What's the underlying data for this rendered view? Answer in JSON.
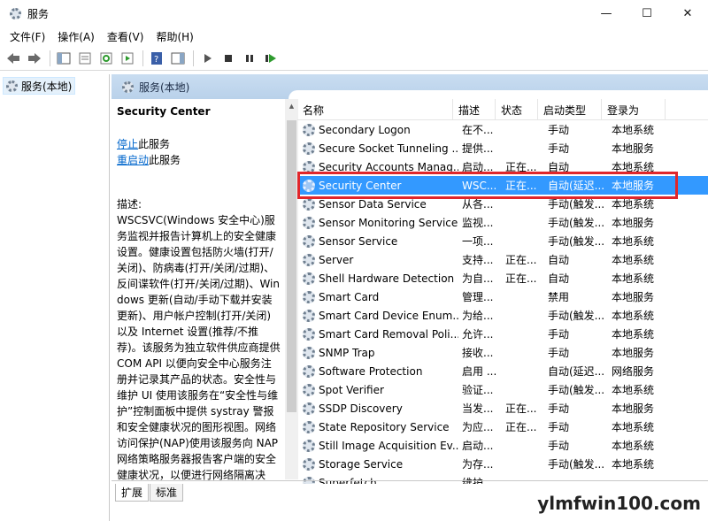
{
  "window": {
    "title": "服务",
    "minimize": "—",
    "maximize": "☐",
    "close": "✕"
  },
  "menu": [
    "文件(F)",
    "操作(A)",
    "查看(V)",
    "帮助(H)"
  ],
  "toolbar": {
    "icons": [
      "back-icon",
      "forward-icon",
      "show-tree-icon",
      "properties-icon",
      "refresh-icon",
      "export-list-icon",
      "help-icon",
      "show-action-pane-icon",
      "start-icon",
      "stop-icon",
      "pause-icon",
      "restart-icon"
    ]
  },
  "tree": {
    "item": "服务(本地)"
  },
  "pane": {
    "header": "服务(本地)"
  },
  "desc": {
    "service_title": "Security Center",
    "stop_link": "停止",
    "stop_rest": "此服务",
    "restart_link": "重启动",
    "restart_rest": "此服务",
    "label": "描述:",
    "text": "WSCSVC(Windows 安全中心)服务监视并报告计算机上的安全健康设置。健康设置包括防火墙(打开/关闭)、防病毒(打开/关闭/过期)、反间谍软件(打开/关闭/过期)、Windows 更新(自动/手动下载并安装更新)、用户帐户控制(打开/关闭)以及 Internet 设置(推荐/不推荐)。该服务为独立软件供应商提供 COM API 以便向安全中心服务注册并记录其产品的状态。安全性与维护 UI 使用该服务在“安全性与维护”控制面板中提供 systray 警报和安全健康状况的图形视图。网络访问保护(NAP)使用该服务向 NAP 网络策略服务器报告客户端的安全健康状况，以便进行网络隔离决策。该服务还提供一个公共"
  },
  "columns": [
    "名称",
    "描述",
    "状态",
    "启动类型",
    "登录为"
  ],
  "services": [
    {
      "name": "Secondary Logon",
      "desc": "在不...",
      "status": "",
      "startup": "手动",
      "logon": "本地系统"
    },
    {
      "name": "Secure Socket Tunneling ...",
      "desc": "提供...",
      "status": "",
      "startup": "手动",
      "logon": "本地服务"
    },
    {
      "name": "Security Accounts Manag...",
      "desc": "启动...",
      "status": "正在...",
      "startup": "自动",
      "logon": "本地系统"
    },
    {
      "name": "Security Center",
      "desc": "WSC...",
      "status": "正在...",
      "startup": "自动(延迟...",
      "logon": "本地服务"
    },
    {
      "name": "Sensor Data Service",
      "desc": "从各...",
      "status": "",
      "startup": "手动(触发...",
      "logon": "本地系统"
    },
    {
      "name": "Sensor Monitoring Service",
      "desc": "监视...",
      "status": "",
      "startup": "手动(触发...",
      "logon": "本地服务"
    },
    {
      "name": "Sensor Service",
      "desc": "一项...",
      "status": "",
      "startup": "手动(触发...",
      "logon": "本地系统"
    },
    {
      "name": "Server",
      "desc": "支持...",
      "status": "正在...",
      "startup": "自动",
      "logon": "本地系统"
    },
    {
      "name": "Shell Hardware Detection",
      "desc": "为自...",
      "status": "正在...",
      "startup": "自动",
      "logon": "本地系统"
    },
    {
      "name": "Smart Card",
      "desc": "管理...",
      "status": "",
      "startup": "禁用",
      "logon": "本地服务"
    },
    {
      "name": "Smart Card Device Enum...",
      "desc": "为给...",
      "status": "",
      "startup": "手动(触发...",
      "logon": "本地系统"
    },
    {
      "name": "Smart Card Removal Poli...",
      "desc": "允许...",
      "status": "",
      "startup": "手动",
      "logon": "本地系统"
    },
    {
      "name": "SNMP Trap",
      "desc": "接收...",
      "status": "",
      "startup": "手动",
      "logon": "本地服务"
    },
    {
      "name": "Software Protection",
      "desc": "启用 ...",
      "status": "",
      "startup": "自动(延迟...",
      "logon": "网络服务"
    },
    {
      "name": "Spot Verifier",
      "desc": "验证...",
      "status": "",
      "startup": "手动(触发...",
      "logon": "本地系统"
    },
    {
      "name": "SSDP Discovery",
      "desc": "当发...",
      "status": "正在...",
      "startup": "手动",
      "logon": "本地服务"
    },
    {
      "name": "State Repository Service",
      "desc": "为应...",
      "status": "正在...",
      "startup": "手动",
      "logon": "本地系统"
    },
    {
      "name": "Still Image Acquisition Ev...",
      "desc": "启动...",
      "status": "",
      "startup": "手动",
      "logon": "本地系统"
    },
    {
      "name": "Storage Service",
      "desc": "为存...",
      "status": "",
      "startup": "手动(触发...",
      "logon": "本地系统"
    },
    {
      "name": "Superfetch",
      "desc": "维护...",
      "status": "",
      "startup": "",
      "logon": ""
    }
  ],
  "selected_index": 3,
  "tabs": [
    "扩展",
    "标准"
  ],
  "watermark": "ylmfwin100.com"
}
